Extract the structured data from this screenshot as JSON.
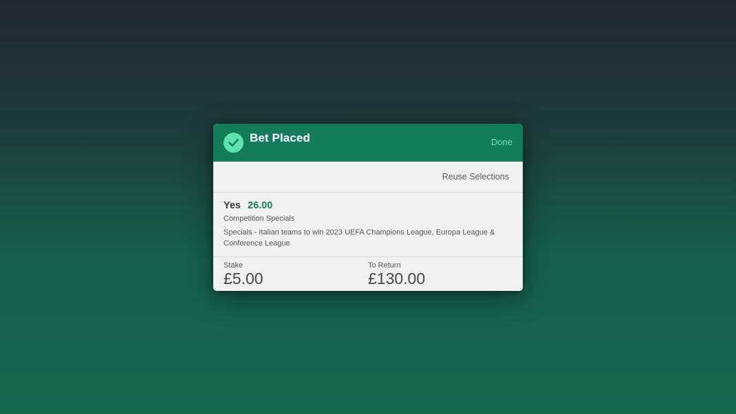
{
  "header": {
    "title": "Bet Placed",
    "done_label": "Done",
    "accent_color": "#137c58",
    "check_icon": "check-circle-icon"
  },
  "actions": {
    "reuse_label": "Reuse Selections"
  },
  "selection": {
    "name": "Yes",
    "odds": "26.00",
    "market": "Competition Specials",
    "event": "Specials - Italian teams to win 2023 UEFA Champions League, Europa League & Conference League"
  },
  "totals": {
    "stake_label": "Stake",
    "stake_value": "£5.00",
    "return_label": "To Return",
    "return_value": "£130.00"
  }
}
